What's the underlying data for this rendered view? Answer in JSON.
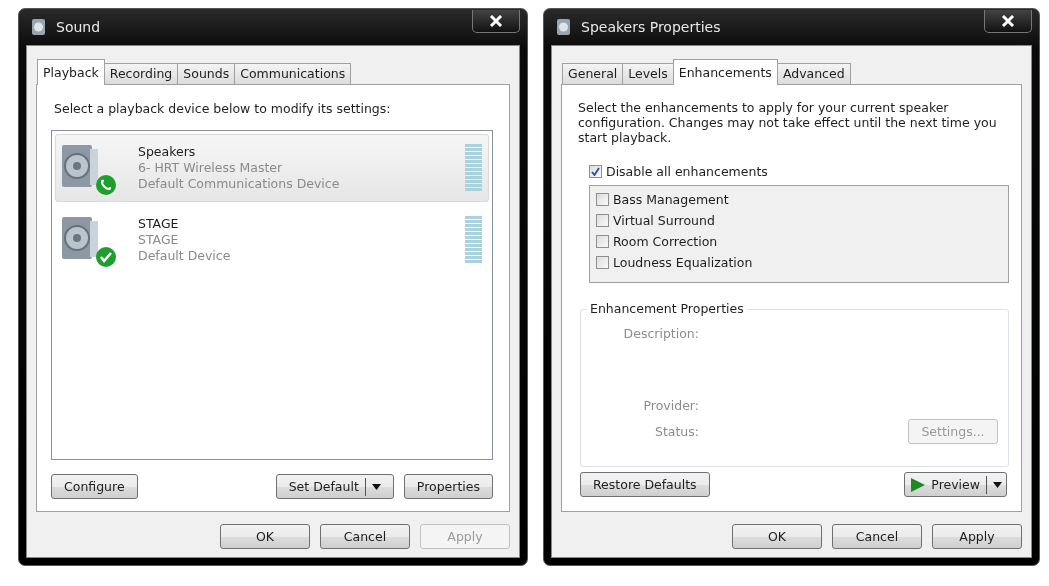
{
  "sound_window": {
    "title": "Sound",
    "tabs": [
      {
        "label": "Playback",
        "selected": true
      },
      {
        "label": "Recording",
        "selected": false
      },
      {
        "label": "Sounds",
        "selected": false
      },
      {
        "label": "Communications",
        "selected": false
      }
    ],
    "instruction": "Select a playback device below to modify its settings:",
    "devices": [
      {
        "name": "Speakers",
        "description": "6- HRT Wireless Master",
        "status": "Default Communications Device",
        "kind": "phone",
        "selected": true
      },
      {
        "name": "STAGE",
        "description": "STAGE",
        "status": "Default Device",
        "kind": "check",
        "selected": false
      }
    ],
    "panel_buttons": [
      {
        "label": "Configure",
        "kind": "plain",
        "disabled": false
      },
      {
        "label": "Set Default",
        "kind": "split",
        "disabled": false
      },
      {
        "label": "Properties",
        "kind": "plain",
        "disabled": false
      }
    ],
    "dialog_buttons": [
      {
        "label": "OK",
        "disabled": false
      },
      {
        "label": "Cancel",
        "disabled": false
      },
      {
        "label": "Apply",
        "disabled": true
      }
    ]
  },
  "properties_window": {
    "title": "Speakers Properties",
    "tabs": [
      {
        "label": "General",
        "selected": false
      },
      {
        "label": "Levels",
        "selected": false
      },
      {
        "label": "Enhancements",
        "selected": true
      },
      {
        "label": "Advanced",
        "selected": false
      }
    ],
    "instruction": "Select the enhancements to apply for your current speaker configuration. Changes may not take effect until the next time you start playback.",
    "disable_all": {
      "label": "Disable all enhancements",
      "checked": true
    },
    "enhancements": [
      {
        "label": "Bass Management",
        "checked": false
      },
      {
        "label": "Virtual Surround",
        "checked": false
      },
      {
        "label": "Room Correction",
        "checked": false
      },
      {
        "label": "Loudness Equalization",
        "checked": false
      }
    ],
    "group": {
      "title": "Enhancement Properties",
      "description_label": "Description:",
      "provider_label": "Provider:",
      "status_label": "Status:",
      "settings_button": {
        "label": "Settings...",
        "disabled": true
      }
    },
    "restore_button": "Restore Defaults",
    "preview_button": "Preview",
    "dialog_buttons": [
      {
        "label": "OK",
        "disabled": false
      },
      {
        "label": "Cancel",
        "disabled": false
      },
      {
        "label": "Apply",
        "disabled": false
      }
    ]
  }
}
